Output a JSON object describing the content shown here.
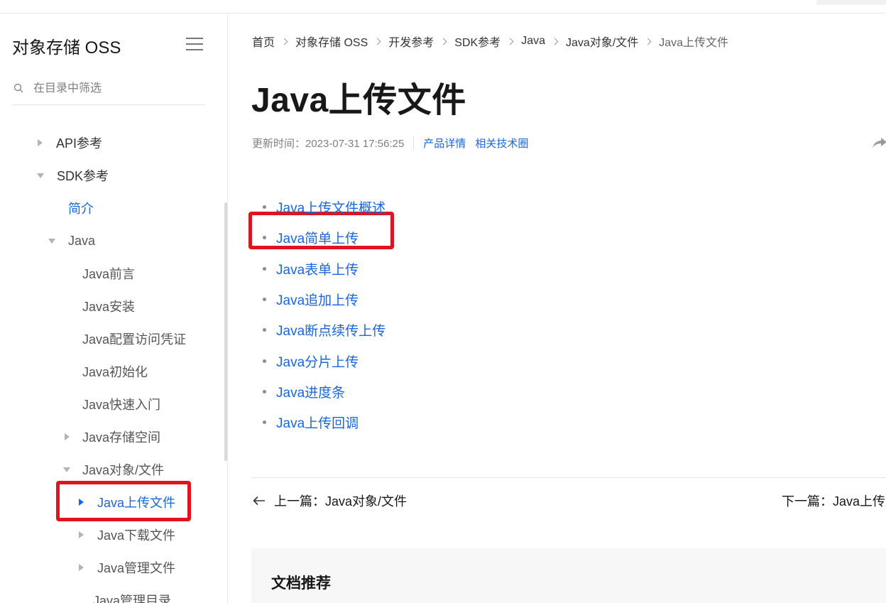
{
  "sidebar": {
    "title": "对象存储 OSS",
    "search_placeholder": "在目录中筛选",
    "items": [
      {
        "label": "API参考"
      },
      {
        "label": "SDK参考"
      },
      {
        "label": "简介"
      },
      {
        "label": "Java"
      },
      {
        "label": "Java前言"
      },
      {
        "label": "Java安装"
      },
      {
        "label": "Java配置访问凭证"
      },
      {
        "label": "Java初始化"
      },
      {
        "label": "Java快速入门"
      },
      {
        "label": "Java存储空间"
      },
      {
        "label": "Java对象/文件"
      },
      {
        "label": "Java上传文件"
      },
      {
        "label": "Java下载文件"
      },
      {
        "label": "Java管理文件"
      },
      {
        "label": "Java管理目录"
      }
    ]
  },
  "breadcrumb": [
    "首页",
    "对象存储 OSS",
    "开发参考",
    "SDK参考",
    "Java",
    "Java对象/文件",
    "Java上传文件"
  ],
  "page": {
    "title": "Java上传文件",
    "updated": "更新时间：2023-07-31 17:56:25",
    "links": [
      "产品详情",
      "相关技术圈"
    ]
  },
  "toc": [
    "Java上传文件概述",
    "Java简单上传",
    "Java表单上传",
    "Java追加上传",
    "Java断点续传上传",
    "Java分片上传",
    "Java进度条",
    "Java上传回调"
  ],
  "pager": {
    "prev": "上一篇：Java对象/文件",
    "next": "下一篇：Java上传文件概述"
  },
  "recommend": {
    "title": "文档推荐"
  },
  "colors": {
    "link": "#1a66e0",
    "highlight": "#e0141e"
  }
}
